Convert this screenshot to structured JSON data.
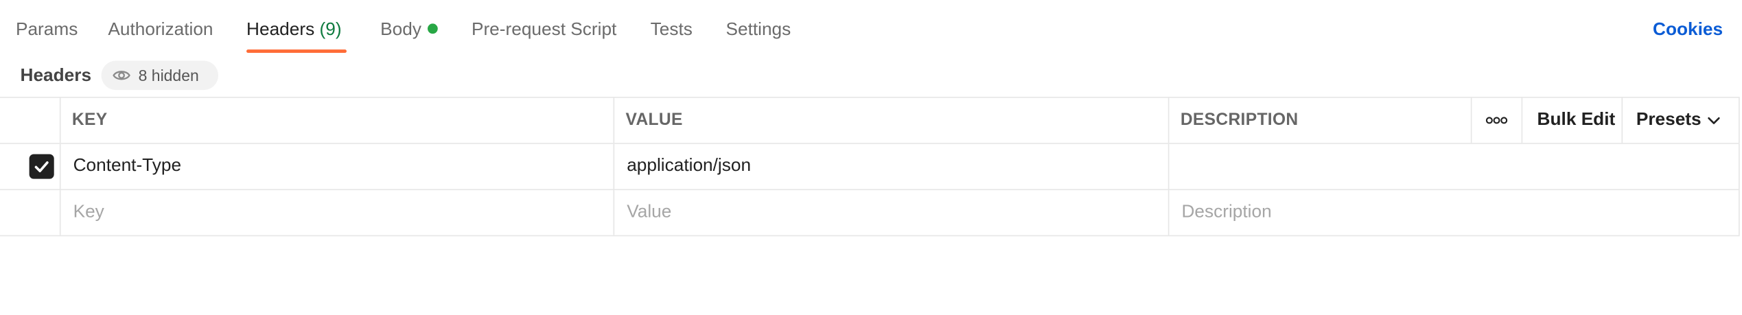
{
  "tabs": [
    {
      "label": "Params"
    },
    {
      "label": "Authorization"
    },
    {
      "label": "Headers",
      "count": "(9)"
    },
    {
      "label": "Body"
    },
    {
      "label": "Pre-request Script"
    },
    {
      "label": "Tests"
    },
    {
      "label": "Settings"
    }
  ],
  "active_tab": "Headers",
  "cookies_label": "Cookies",
  "subheader": {
    "title": "Headers",
    "hidden_label": "8 hidden"
  },
  "table": {
    "columns": {
      "key": "KEY",
      "value": "VALUE",
      "description": "DESCRIPTION"
    },
    "actions": {
      "more_icon": "more-horizontal-icon",
      "bulk_edit": "Bulk Edit",
      "presets": "Presets"
    },
    "rows": [
      {
        "checked": true,
        "key": "Content-Type",
        "value": "application/json",
        "description": ""
      }
    ],
    "new_row": {
      "key_placeholder": "Key",
      "value_placeholder": "Value",
      "description_placeholder": "Description"
    }
  },
  "colors": {
    "accent": "#ff6c37",
    "link": "#0b5cd5",
    "status_dot": "#28a745",
    "count": "#0f7b3f"
  }
}
